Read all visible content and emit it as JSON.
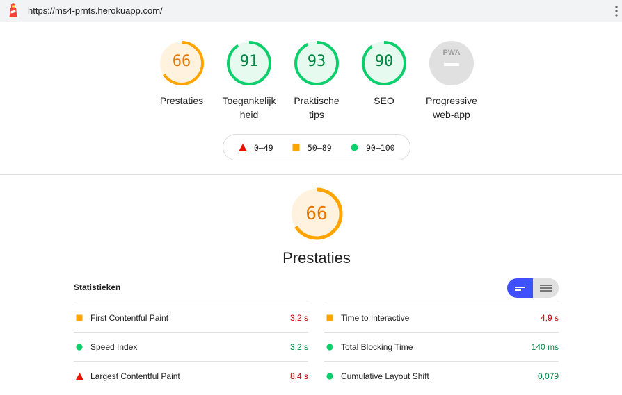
{
  "browser": {
    "url": "https://ms4-prnts.herokuapp.com/"
  },
  "colors": {
    "fail": "#eb0f00",
    "average": "#ffa400",
    "pass": "#0cce6b",
    "average_text": "#e67700",
    "pass_text": "#018642",
    "pass_green_text": "#0cce6b",
    "fail_text": "#c00000",
    "pwa_gray": "#e0e0e0",
    "toggle_active": "#3f51ff"
  },
  "gauges": [
    {
      "score": "66",
      "label_line1": "Prestaties",
      "label_line2": "",
      "rating": "average",
      "value": 66
    },
    {
      "score": "91",
      "label_line1": "Toegankelijk",
      "label_line2": "heid",
      "rating": "pass",
      "value": 91
    },
    {
      "score": "93",
      "label_line1": "Praktische",
      "label_line2": "tips",
      "rating": "pass",
      "value": 93
    },
    {
      "score": "90",
      "label_line1": "SEO",
      "label_line2": "",
      "rating": "pass",
      "value": 90
    },
    {
      "score": "PWA",
      "label_line1": "Progressive",
      "label_line2": "web-app",
      "rating": "pwa",
      "value": 0
    }
  ],
  "legend": {
    "fail_range": "0–49",
    "average_range": "50–89",
    "pass_range": "90–100"
  },
  "category": {
    "score": "66",
    "value": 66,
    "title": "Prestaties"
  },
  "metrics": {
    "title": "Statistieken",
    "left": [
      {
        "name": "First Contentful Paint",
        "value": "3,2 s",
        "rating": "average"
      },
      {
        "name": "Speed Index",
        "value": "3,2 s",
        "rating": "pass"
      },
      {
        "name": "Largest Contentful Paint",
        "value": "8,4 s",
        "rating": "fail"
      }
    ],
    "right": [
      {
        "name": "Time to Interactive",
        "value": "4,9 s",
        "rating": "average"
      },
      {
        "name": "Total Blocking Time",
        "value": "140 ms",
        "rating": "pass"
      },
      {
        "name": "Cumulative Layout Shift",
        "value": "0,079",
        "rating": "pass"
      }
    ]
  },
  "icons": {
    "logo": "lighthouse-icon",
    "menu": "kebab-menu-icon",
    "toggle_compact": "compact-view-icon",
    "toggle_expanded": "expanded-view-icon"
  }
}
